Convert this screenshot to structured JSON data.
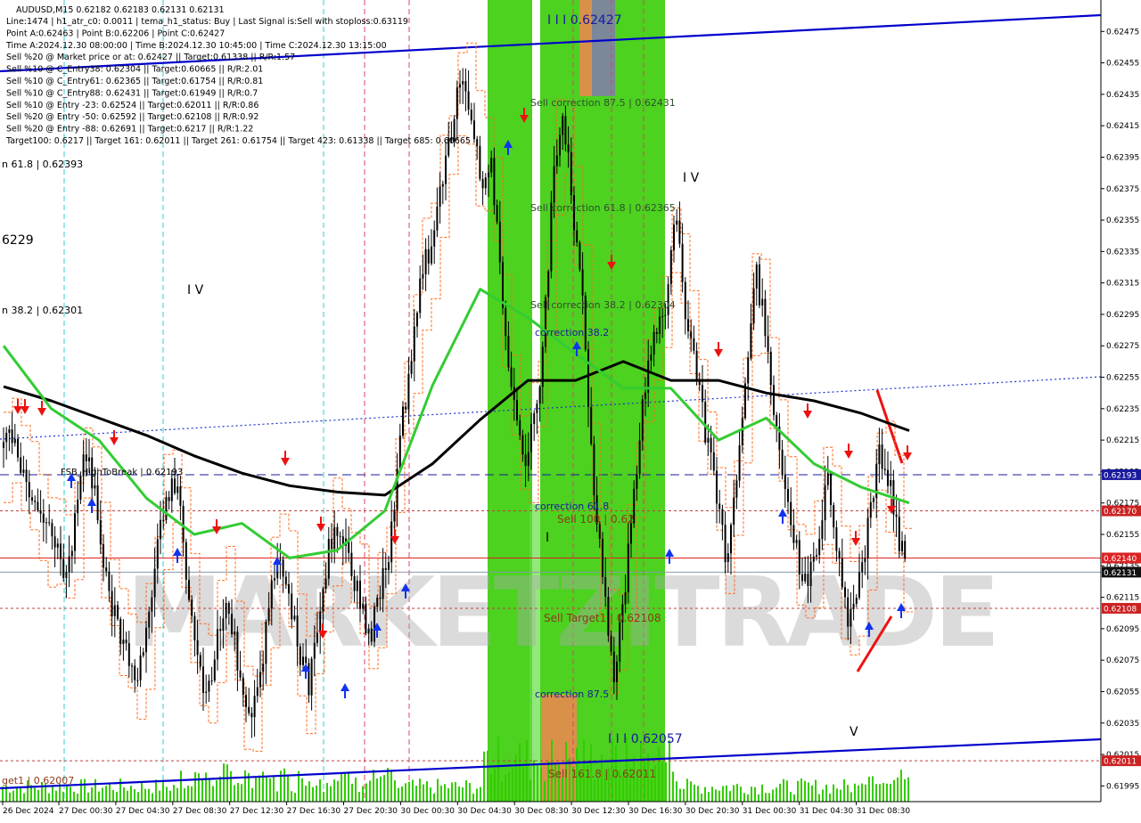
{
  "header": {
    "symbol_line": "AUDUSD,M15   0.62182 0.62183 0.62131 0.62131",
    "info_lines": [
      "Line:1474  |  h1_atr_c0: 0.0011  |  tema_h1_status: Buy  |  Last Signal is:Sell with stoploss:0.63119",
      "Point A:0.62463  |  Point B:0.62206  |  Point C:0.62427",
      "Time A:2024.12.30 08:00:00  |  Time B:2024.12.30 10:45:00  |  Time C:2024.12.30 13:15:00",
      "Sell %20 @ Market price or at: 0.62427  ||  Target:0.61338  ||  R/R:1.57",
      "Sell %10 @ C_Entry38: 0.62304  ||  Target:0.60665  ||  R/R:2.01",
      "Sell %10 @ C_Entry61: 0.62365  ||  Target:0.61754  ||  R/R:0.81",
      "Sell %10 @ C_Entry88: 0.62431  ||  Target:0.61949  ||  R/R:0.7",
      "Sell %10 @ Entry -23: 0.62524  ||  Target:0.62011  ||  R/R:0.86",
      "Sell %20 @ Entry -50: 0.62592  ||  Target:0.62108  ||  R/R:0.92",
      "Sell %20 @ Entry -88: 0.62691  ||  Target:0.6217  ||  R/R:1.22",
      "Target100: 0.6217  ||  Target 161: 0.62011  ||  Target 261: 0.61754  ||  Target 423: 0.61338  ||  Target 685: 0.60665"
    ]
  },
  "watermark": "MARKETZITRADE",
  "chart_labels": [
    {
      "text": "I I I  0.62427",
      "color": "#1a1aa0",
      "size": 14
    },
    {
      "text": "Sell correction 87.5 | 0.62431",
      "color": "#2f4f2f",
      "size": 11
    },
    {
      "text": "Sell correction 61.8 | 0.62365",
      "color": "#2f4f2f",
      "size": 11
    },
    {
      "text": "Sell correction 38.2 | 0.62304",
      "color": "#2f4f2f",
      "size": 11
    },
    {
      "text": "correction 38.2",
      "color": "#1a1aa0",
      "size": 11
    },
    {
      "text": "correction 61.8",
      "color": "#1a1aa0",
      "size": 11
    },
    {
      "text": "correction 87.5",
      "color": "#1a1aa0",
      "size": 11
    },
    {
      "text": "Sell 100 | 0.62",
      "color": "#8b3a1a",
      "size": 12
    },
    {
      "text": "Sell Target1 | 0.62108",
      "color": "#8b3a1a",
      "size": 12
    },
    {
      "text": "Sell 161.8 | 0.62011",
      "color": "#8b3a1a",
      "size": 12
    },
    {
      "text": "I I I  0.62057",
      "color": "#1a1aa0",
      "size": 14
    },
    {
      "text": "I V",
      "color": "#000000",
      "size": 14
    },
    {
      "text": "I V",
      "color": "#000000",
      "size": 14
    },
    {
      "text": "V",
      "color": "#000000",
      "size": 14
    },
    {
      "text": "I",
      "color": "#000000",
      "size": 14
    },
    {
      "text": "n 61.8 | 0.62393",
      "color": "#000000",
      "size": 11
    },
    {
      "text": "n 38.2 | 0.62301",
      "color": "#000000",
      "size": 11
    },
    {
      "text": "6229",
      "color": "#000000",
      "size": 14
    },
    {
      "text": "FSB_HighToBreak | 0.62193",
      "color": "#000000",
      "size": 10
    },
    {
      "text": "get1 | 0.62007",
      "color": "#8b3a1a",
      "size": 11
    }
  ],
  "chart_data": {
    "type": "candlestick",
    "symbol": "AUDUSD",
    "timeframe": "M15",
    "ylim": [
      0.61985,
      0.62495
    ],
    "y_ticks": [
      "0.62475",
      "0.62455",
      "0.62435",
      "0.62415",
      "0.62395",
      "0.62375",
      "0.62355",
      "0.62335",
      "0.62315",
      "0.62295",
      "0.62275",
      "0.62255",
      "0.62235",
      "0.62215",
      "0.62195",
      "0.62175",
      "0.62155",
      "0.62135",
      "0.62115",
      "0.62095",
      "0.62075",
      "0.62055",
      "0.62035",
      "0.62015",
      "0.61995"
    ],
    "x_ticks": [
      "26 Dec 2024",
      "27 Dec 00:30",
      "27 Dec 04:30",
      "27 Dec 08:30",
      "27 Dec 12:30",
      "27 Dec 16:30",
      "27 Dec 20:30",
      "30 Dec 00:30",
      "30 Dec 04:30",
      "30 Dec 08:30",
      "30 Dec 12:30",
      "30 Dec 16:30",
      "30 Dec 20:30",
      "31 Dec 00:30",
      "31 Dec 04:30",
      "31 Dec 08:30"
    ],
    "close_path": [
      0.6221,
      0.6222,
      0.6219,
      0.6217,
      0.6216,
      0.6215,
      0.6213,
      0.6216,
      0.6221,
      0.6218,
      0.6213,
      0.621,
      0.6208,
      0.6206,
      0.6209,
      0.6214,
      0.6218,
      0.6219,
      0.6213,
      0.6208,
      0.6205,
      0.6209,
      0.6212,
      0.6207,
      0.6203,
      0.6206,
      0.621,
      0.6215,
      0.6212,
      0.6208,
      0.6206,
      0.621,
      0.6215,
      0.6216,
      0.6214,
      0.6211,
      0.6209,
      0.6212,
      0.6215,
      0.6222,
      0.6226,
      0.6232,
      0.6234,
      0.6238,
      0.6241,
      0.6245,
      0.6242,
      0.6238,
      0.6239,
      0.623,
      0.6224,
      0.622,
      0.6222,
      0.6227,
      0.6238,
      0.6242,
      0.6236,
      0.623,
      0.6218,
      0.6212,
      0.6206,
      0.6212,
      0.6218,
      0.6225,
      0.6228,
      0.623,
      0.6236,
      0.623,
      0.6226,
      0.6222,
      0.6218,
      0.6214,
      0.6218,
      0.6226,
      0.6232,
      0.6228,
      0.6222,
      0.6218,
      0.6214,
      0.6212,
      0.6215,
      0.6219,
      0.6214,
      0.621,
      0.6212,
      0.6216,
      0.6221,
      0.6219,
      0.6215,
      0.6213
    ],
    "series": [
      {
        "name": "EMA 200",
        "color": "#000000",
        "values": [
          0.62249,
          0.6224,
          0.62229,
          0.62218,
          0.62205,
          0.62194,
          0.62186,
          0.62182,
          0.6218,
          0.622,
          0.62228,
          0.62253,
          0.62253,
          0.62265,
          0.62253,
          0.62253,
          0.62245,
          0.6224,
          0.62232,
          0.62221
        ]
      },
      {
        "name": "EMA 50",
        "color": "#33cc33",
        "values": [
          0.62275,
          0.62235,
          0.62215,
          0.62178,
          0.62155,
          0.62162,
          0.6214,
          0.62145,
          0.6217,
          0.6225,
          0.62311,
          0.62293,
          0.6227,
          0.62248,
          0.62248,
          0.62215,
          0.62229,
          0.622,
          0.62185,
          0.62175
        ]
      }
    ],
    "horizontal_levels": [
      {
        "value": 0.62193,
        "style": "dashed",
        "color": "#1a1aa0",
        "label": "0.62193",
        "bg": "#1a1aa0"
      },
      {
        "value": 0.6217,
        "style": "dotted",
        "color": "#c04040",
        "label": "0.62170",
        "bg": "#cc2222"
      },
      {
        "value": 0.6214,
        "style": "solid",
        "color": "#dd2222",
        "label": "0.62140",
        "bg": "#dd2222"
      },
      {
        "value": 0.62131,
        "style": "solid",
        "color": "#8899aa",
        "label": "0.62131",
        "bg": "#111111"
      },
      {
        "value": 0.62108,
        "style": "dotted",
        "color": "#c04040",
        "label": "0.62108",
        "bg": "#cc2222"
      },
      {
        "value": 0.62011,
        "style": "dotted",
        "color": "#c04040",
        "label": "0.62011",
        "bg": "#cc2222"
      }
    ],
    "channel_lines": [
      {
        "name": "upper channel",
        "color": "#0000cc"
      },
      {
        "name": "lower channel",
        "color": "#0000cc"
      },
      {
        "name": "dotted trend",
        "color": "#2233cc"
      }
    ],
    "zones": [
      {
        "name": "green zone 1",
        "color": "#33cc00"
      },
      {
        "name": "green zone 2",
        "color": "#33cc00"
      },
      {
        "name": "target box orange",
        "color": "#d9914a"
      },
      {
        "name": "target box gray",
        "color": "#7a8899"
      }
    ]
  }
}
